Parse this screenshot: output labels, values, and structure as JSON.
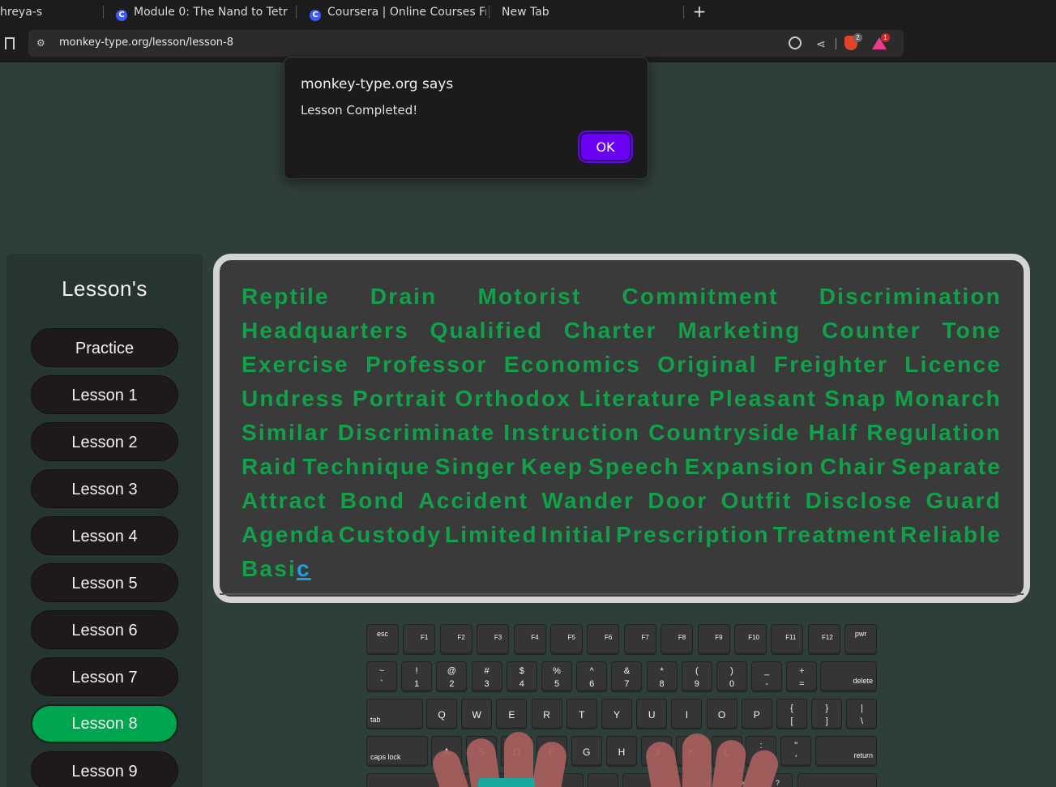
{
  "browser": {
    "tabs": [
      {
        "title": "hreya-s",
        "has_favicon": false
      },
      {
        "title": "Module 0: The Nand to Tetri",
        "has_favicon": true,
        "favicon": "C"
      },
      {
        "title": "Coursera | Online Courses Fr",
        "has_favicon": true,
        "favicon": "C"
      },
      {
        "title": "New Tab",
        "has_favicon": false
      }
    ],
    "new_tab_icon": "+",
    "url": "monkey-type.org/lesson/lesson-8",
    "brave_shields_count": "2",
    "rewards_count": "1",
    "icons": [
      "bookmark-icon",
      "site-settings-icon",
      "zoom-icon",
      "share-icon",
      "brave-shields-icon",
      "brave-rewards-icon"
    ]
  },
  "alert": {
    "title": "monkey-type.org says",
    "message": "Lesson Completed!",
    "ok_label": "OK",
    "ok_color": "#6a00f4"
  },
  "sidebar": {
    "title": "Lesson's",
    "items": [
      {
        "label": "Practice",
        "active": false
      },
      {
        "label": "Lesson 1",
        "active": false
      },
      {
        "label": "Lesson 2",
        "active": false
      },
      {
        "label": "Lesson 3",
        "active": false
      },
      {
        "label": "Lesson 4",
        "active": false
      },
      {
        "label": "Lesson 5",
        "active": false
      },
      {
        "label": "Lesson 6",
        "active": false
      },
      {
        "label": "Lesson 7",
        "active": false
      },
      {
        "label": "Lesson 8",
        "active": true
      },
      {
        "label": "Lesson 9",
        "active": false
      }
    ],
    "active_color": "#00a64f"
  },
  "lesson_text": {
    "typed_color": "#13a04a",
    "caret_color": "#1ea0d6",
    "lines": [
      [
        "Reptile",
        "Drain",
        "Motorist",
        "Commitment",
        "Discrimination"
      ],
      [
        "Headquarters",
        "Qualified",
        "Charter",
        "Marketing",
        "Counter",
        "Tone"
      ],
      [
        "Exercise",
        "Professor",
        "Economics",
        "Original",
        "Freighter",
        "Licence"
      ],
      [
        "Undress",
        "Portrait",
        "Orthodox",
        "Literature",
        "Pleasant",
        "Snap",
        "Monarch"
      ],
      [
        "Similar",
        "Discriminate",
        "Instruction",
        "Countryside",
        "Half",
        "Regulation"
      ],
      [
        "Raid",
        "Technique",
        "Singer",
        "Keep",
        "Speech",
        "Expansion",
        "Chair",
        "Separate"
      ],
      [
        "Attract",
        "Bond",
        "Accident",
        "Wander",
        "Door",
        "Outfit",
        "Disclose",
        "Guard"
      ],
      [
        "Agenda",
        "Custody",
        "Limited",
        "Initial",
        "Prescription",
        "Treatment",
        "Reliable"
      ]
    ],
    "last_line_typed": "Basi",
    "last_line_caret": "c"
  },
  "keyboard": {
    "row0": [
      {
        "label": "esc"
      },
      {
        "label": "F1"
      },
      {
        "label": "F2"
      },
      {
        "label": "F3"
      },
      {
        "label": "F4"
      },
      {
        "label": "F5"
      },
      {
        "label": "F6"
      },
      {
        "label": "F7"
      },
      {
        "label": "F8"
      },
      {
        "label": "F9"
      },
      {
        "label": "F10"
      },
      {
        "label": "F11"
      },
      {
        "label": "F12"
      },
      {
        "label": "pwr"
      }
    ],
    "row1": [
      {
        "top": "~",
        "bot": "`"
      },
      {
        "top": "!",
        "bot": "1"
      },
      {
        "top": "@",
        "bot": "2"
      },
      {
        "top": "#",
        "bot": "3"
      },
      {
        "top": "$",
        "bot": "4"
      },
      {
        "top": "%",
        "bot": "5"
      },
      {
        "top": "^",
        "bot": "6"
      },
      {
        "top": "&",
        "bot": "7"
      },
      {
        "top": "*",
        "bot": "8"
      },
      {
        "top": "(",
        "bot": "9"
      },
      {
        "top": ")",
        "bot": "0"
      },
      {
        "top": "_",
        "bot": "-"
      },
      {
        "top": "+",
        "bot": "="
      }
    ],
    "delete_label": "delete",
    "tab_label": "tab",
    "row2": [
      "Q",
      "W",
      "E",
      "R",
      "T",
      "Y",
      "U",
      "I",
      "O",
      "P"
    ],
    "row2_sym": [
      {
        "top": "{",
        "bot": "["
      },
      {
        "top": "}",
        "bot": "]"
      },
      {
        "top": "|",
        "bot": "\\"
      }
    ],
    "caps_label": "caps lock",
    "row3": [
      "A",
      "S",
      "D",
      "F",
      "G",
      "H",
      "J",
      "K",
      "L"
    ],
    "row3_sym": [
      {
        "top": ":",
        "bot": ";"
      },
      {
        "top": "\"",
        "bot": "'"
      }
    ],
    "return_label": "return",
    "row4_partial": [
      "<",
      ">",
      "?"
    ]
  }
}
